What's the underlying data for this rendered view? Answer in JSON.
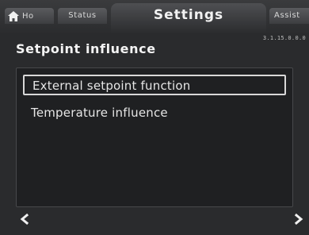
{
  "tabs": {
    "home": {
      "label": "Ho",
      "icon": "home-icon"
    },
    "status": {
      "label": "Status"
    },
    "settings": {
      "label": "Settings"
    },
    "assist": {
      "label": "Assist"
    }
  },
  "page": {
    "number": "3.1.15.0.0.0",
    "title": "Setpoint influence"
  },
  "list": {
    "items": [
      {
        "label": "External setpoint function",
        "selected": true
      },
      {
        "label": "Temperature influence",
        "selected": false
      }
    ]
  },
  "nav": {
    "back_icon": "chevron-left-icon",
    "forward_icon": "chevron-right-icon"
  },
  "colors": {
    "background": "#2a2b2d",
    "panel": "#1f2022",
    "text": "#e6e6e6",
    "selection_border": "#d8d8d8"
  }
}
